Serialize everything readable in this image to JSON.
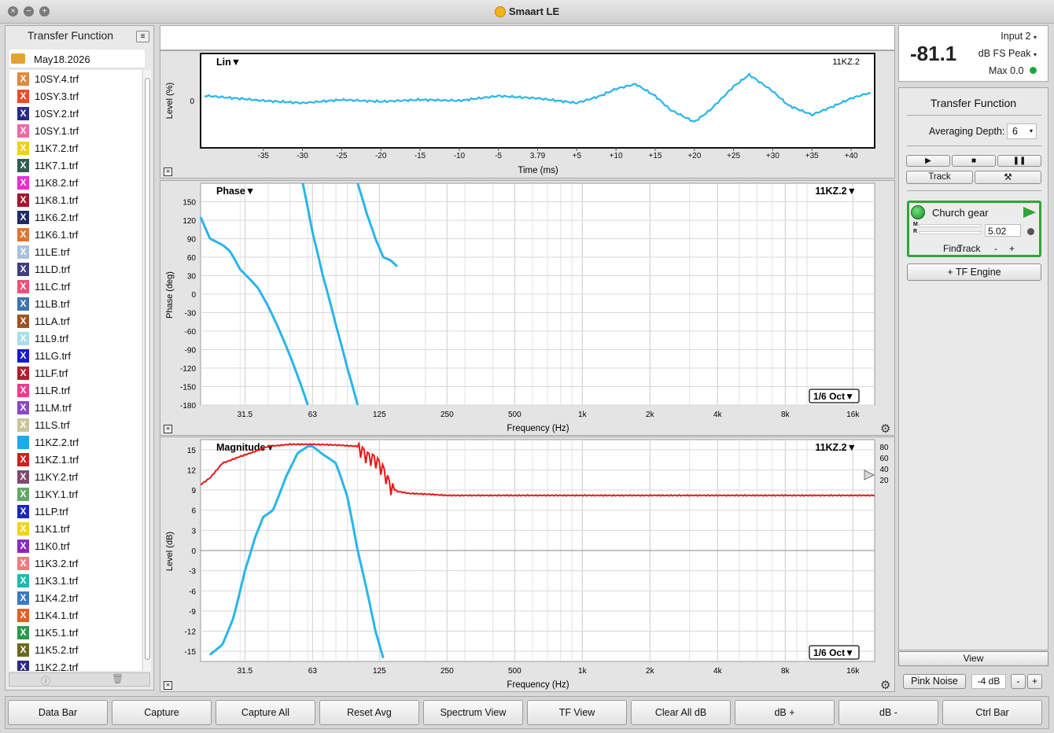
{
  "window": {
    "title": "Smaart LE"
  },
  "left_panel": {
    "title": "Transfer Function",
    "folder": "May18.2026",
    "files": [
      {
        "name": "10SY.4.trf",
        "color": "#e2883a"
      },
      {
        "name": "10SY.3.trf",
        "color": "#e84d24"
      },
      {
        "name": "10SY.2.trf",
        "color": "#2a2a8a"
      },
      {
        "name": "10SY.1.trf",
        "color": "#ec6aa8"
      },
      {
        "name": "11K7.2.trf",
        "color": "#f2d019"
      },
      {
        "name": "11K7.1.trf",
        "color": "#2d5e52"
      },
      {
        "name": "11K8.2.trf",
        "color": "#ec2bd4"
      },
      {
        "name": "11K8.1.trf",
        "color": "#a5162a"
      },
      {
        "name": "11K6.2.trf",
        "color": "#1d2a66"
      },
      {
        "name": "11K6.1.trf",
        "color": "#e0742e"
      },
      {
        "name": "11LE.trf",
        "color": "#a9c1e0"
      },
      {
        "name": "11LD.trf",
        "color": "#3e3e80"
      },
      {
        "name": "11LC.trf",
        "color": "#f0507a"
      },
      {
        "name": "11LB.trf",
        "color": "#3d74b0"
      },
      {
        "name": "11LA.trf",
        "color": "#a0521e"
      },
      {
        "name": "11L9.trf",
        "color": "#a9dfe8"
      },
      {
        "name": "11LG.trf",
        "color": "#1a1ad0"
      },
      {
        "name": "11LF.trf",
        "color": "#b01e2a"
      },
      {
        "name": "11LR.trf",
        "color": "#f03b8d"
      },
      {
        "name": "11LM.trf",
        "color": "#8a4ac8"
      },
      {
        "name": "11LS.trf",
        "color": "#c9c49a"
      },
      {
        "name": "11KZ.2.trf",
        "color": "#1fa9e8"
      },
      {
        "name": "11KZ.1.trf",
        "color": "#d0201e"
      },
      {
        "name": "11KY.2.trf",
        "color": "#804a6e"
      },
      {
        "name": "11KY.1.trf",
        "color": "#64a868"
      },
      {
        "name": "11LP.trf",
        "color": "#1a2ab0"
      },
      {
        "name": "11K1.trf",
        "color": "#f2d31b"
      },
      {
        "name": "11K0.trf",
        "color": "#8a2ac0"
      },
      {
        "name": "11K3.2.trf",
        "color": "#f07a80"
      },
      {
        "name": "11K3.1.trf",
        "color": "#1ebab0"
      },
      {
        "name": "11K4.2.trf",
        "color": "#3b78c4"
      },
      {
        "name": "11K4.1.trf",
        "color": "#e06020"
      },
      {
        "name": "11K5.1.trf",
        "color": "#2a9a4a"
      },
      {
        "name": "11K5.2.trf",
        "color": "#6a6a1e"
      },
      {
        "name": "11K2.2.trf",
        "color": "#2a2a88"
      }
    ]
  },
  "ir_plot": {
    "mode_label": "Lin",
    "trace_label": "11KZ.2",
    "ylabel": "Level (%)",
    "y_tick": "0",
    "xlabel": "Time (ms)",
    "x_ticks": [
      "-35",
      "-30",
      "-25",
      "-20",
      "-15",
      "-10",
      "-5",
      "3.79",
      "+5",
      "+10",
      "+15",
      "+20",
      "+25",
      "+30",
      "+35",
      "+40"
    ]
  },
  "phase_plot": {
    "label": "Phase",
    "trace_label": "11KZ.2",
    "ylabel": "Phase (deg)",
    "y_ticks": [
      "150",
      "120",
      "90",
      "60",
      "30",
      "0",
      "-30",
      "-60",
      "-90",
      "-120",
      "-150",
      "-180"
    ],
    "xlabel": "Frequency (Hz)",
    "x_ticks": [
      "31.5",
      "63",
      "125",
      "250",
      "500",
      "1k",
      "2k",
      "4k",
      "8k",
      "16k"
    ],
    "smoothing": "1/6 Oct"
  },
  "mag_plot": {
    "label": "Magnitude",
    "trace_label": "11KZ.2",
    "ylabel": "Level (dB)",
    "y_ticks": [
      "15",
      "12",
      "9",
      "6",
      "3",
      "0",
      "-3",
      "-6",
      "-9",
      "-12",
      "-15"
    ],
    "coherence_ticks": [
      "80",
      "60",
      "40",
      "20"
    ],
    "xlabel": "Frequency (Hz)",
    "x_ticks": [
      "31.5",
      "63",
      "125",
      "250",
      "500",
      "1k",
      "2k",
      "4k",
      "8k",
      "16k"
    ],
    "smoothing": "1/6 Oct"
  },
  "meter": {
    "input": "Input 2",
    "value": "-81.1",
    "unit": "dB FS Peak",
    "max": "Max 0.0"
  },
  "tf_panel": {
    "title": "Transfer Function",
    "avg_label": "Averaging Depth:",
    "avg_value": "6",
    "track_label": "Track",
    "engine": {
      "name": "Church gear",
      "m": "M",
      "r": "R",
      "delay": "5.02",
      "find": "Find",
      "track": "Track",
      "minus": "-",
      "plus": "+"
    },
    "add_engine": "+ TF Engine",
    "view": "View"
  },
  "signal": {
    "label": "Pink Noise",
    "level": "-4 dB",
    "minus": "-",
    "plus": "+"
  },
  "bottom_buttons": [
    "Data Bar",
    "Capture",
    "Capture All",
    "Reset Avg",
    "Spectrum View",
    "TF View",
    "Clear All dB",
    "dB +",
    "dB -",
    "Ctrl Bar"
  ],
  "colors": {
    "trace_blue": "#29b5ea",
    "coherence_red": "#e81818",
    "engine_green": "#2fa537"
  },
  "chart_data": [
    {
      "type": "line",
      "title": "Lin",
      "xlabel": "Time (ms)",
      "ylabel": "Level (%)",
      "series": [
        {
          "name": "11KZ.2",
          "x": [
            -42,
            -35,
            -30,
            -25,
            -20,
            -15,
            -10,
            -5,
            0,
            5,
            8,
            10,
            12.5,
            15,
            17,
            20,
            22,
            25,
            27,
            30,
            32,
            35,
            38,
            40,
            42
          ],
          "y": [
            0.1,
            0,
            -0.05,
            0.02,
            -0.02,
            0.02,
            0,
            0.1,
            0.05,
            -0.05,
            0.1,
            0.25,
            0.35,
            0.1,
            -0.2,
            -0.45,
            -0.2,
            0.3,
            0.55,
            0.2,
            -0.1,
            -0.3,
            -0.1,
            0.05,
            0.15
          ]
        }
      ],
      "xlim": [
        -43,
        43
      ],
      "ylim": [
        -1,
        1
      ]
    },
    {
      "type": "line",
      "title": "Phase",
      "xlabel": "Frequency (Hz)",
      "ylabel": "Phase (deg)",
      "series": [
        {
          "name": "11KZ.2",
          "x": [
            20,
            22,
            25,
            27,
            30,
            33,
            36,
            40,
            45,
            50,
            55,
            60
          ],
          "y": [
            125,
            90,
            80,
            70,
            40,
            25,
            10,
            -20,
            -60,
            -100,
            -140,
            -180
          ]
        },
        {
          "name": "11KZ.2 (wrap 2)",
          "x": [
            57,
            63,
            70,
            80,
            90,
            100
          ],
          "y": [
            180,
            100,
            30,
            -50,
            -120,
            -180
          ]
        },
        {
          "name": "11KZ.2 (wrap 3)",
          "x": [
            100,
            110,
            120,
            130,
            140,
            150
          ],
          "y": [
            180,
            130,
            90,
            60,
            55,
            45
          ]
        }
      ],
      "xscale": "log",
      "xlim": [
        20,
        20000
      ],
      "ylim": [
        -180,
        180
      ]
    },
    {
      "type": "line",
      "title": "Magnitude",
      "xlabel": "Frequency (Hz)",
      "ylabel": "Level (dB)",
      "series": [
        {
          "name": "11KZ.2",
          "x": [
            22,
            25,
            28,
            31.5,
            35,
            38,
            42,
            48,
            54,
            60,
            63,
            70,
            80,
            90,
            100,
            110,
            120,
            130
          ],
          "y": [
            -15.5,
            -14,
            -10,
            -3,
            2,
            5,
            6,
            11,
            14.5,
            15.5,
            15.5,
            14.3,
            13,
            8,
            0,
            -6,
            -12,
            -16
          ]
        },
        {
          "name": "Coherence",
          "x": [
            20,
            22,
            25,
            30,
            40,
            50,
            63,
            80,
            100,
            110,
            120,
            130,
            140,
            150,
            170,
            200,
            250,
            500,
            1000,
            20000
          ],
          "y": [
            9.8,
            10.8,
            13,
            14,
            15.5,
            15.8,
            15.8,
            15.7,
            15.5,
            14,
            13.5,
            12,
            9.5,
            8.8,
            8.5,
            8.4,
            8.2,
            8.2,
            8.2,
            8.2
          ]
        }
      ],
      "xscale": "log",
      "xlim": [
        20,
        20000
      ],
      "ylim": [
        -16.5,
        16.5
      ]
    }
  ]
}
